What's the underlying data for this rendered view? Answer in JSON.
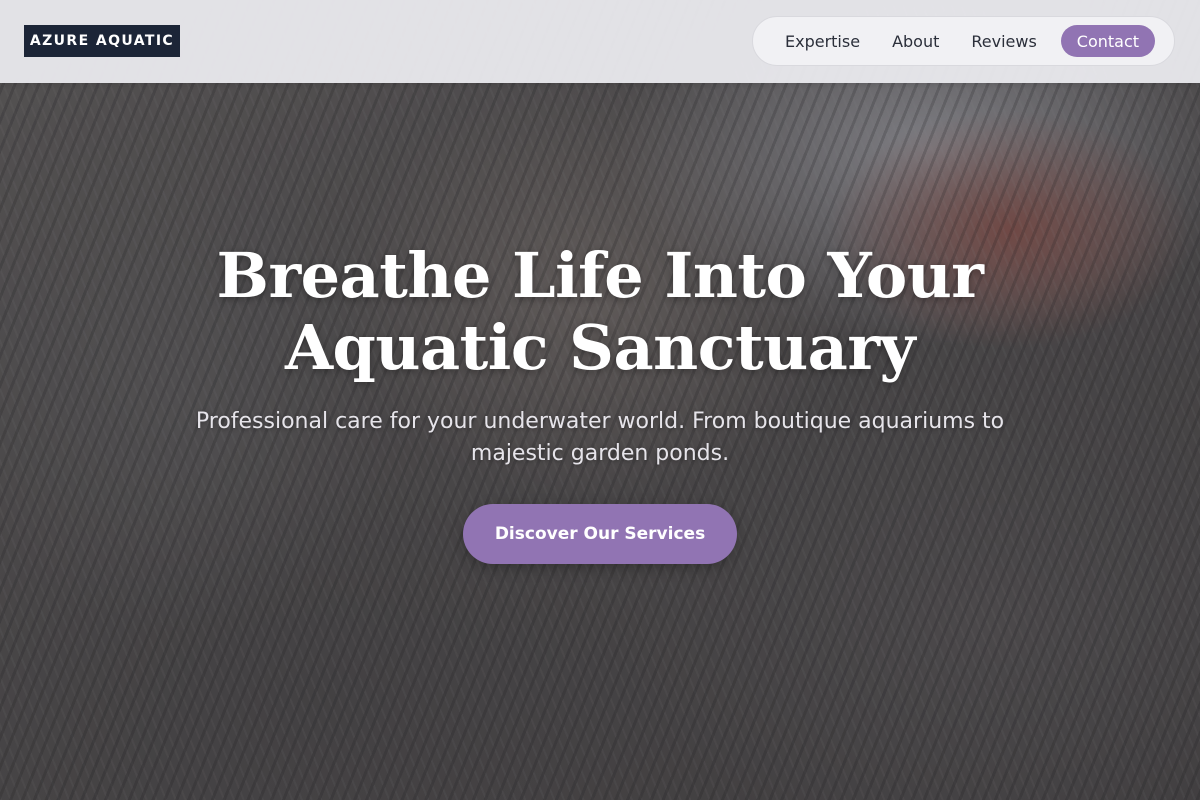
{
  "header": {
    "logo_text": "AZURE AQUATIC",
    "nav": [
      {
        "label": "Expertise"
      },
      {
        "label": "About"
      },
      {
        "label": "Reviews"
      },
      {
        "label": "Contact",
        "active": true
      }
    ]
  },
  "hero": {
    "title_line1": "Breathe Life Into Your",
    "title_line2": "Aquatic Sanctuary",
    "subtitle_line1": "Professional care for your underwater world. From boutique aquariums to",
    "subtitle_line2": "majestic garden ponds.",
    "cta_label": "Discover Our Services",
    "background_image": "tabby-cats-photo"
  },
  "colors": {
    "accent": "#9174b3",
    "logo_bg": "#1c2537",
    "header_bg": "#e8e8ec"
  }
}
